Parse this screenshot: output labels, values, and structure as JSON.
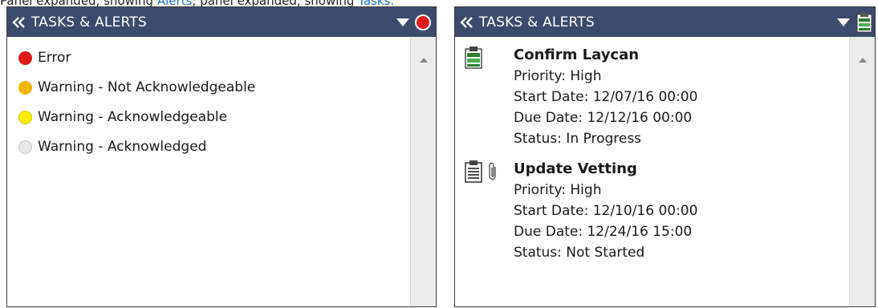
{
  "caption": {
    "text_before": "Panel expanded, showing ",
    "alerts_link": "Alerts",
    "text_middle": "; panel expanded, showing ",
    "tasks_link": "Tasks."
  },
  "alerts_panel": {
    "title": "TASKS & ALERTS",
    "legend": [
      {
        "label": "Error",
        "color": "#e01818"
      },
      {
        "label": "Warning - Not Acknowledgeable",
        "color": "#f4b400"
      },
      {
        "label": "Warning - Acknowledgeable",
        "color": "#ffee00"
      },
      {
        "label": "Warning - Acknowledged",
        "color": "#e8e8e8"
      }
    ]
  },
  "tasks_panel": {
    "title": "TASKS & ALERTS",
    "tasks": [
      {
        "title": "Confirm Laycan",
        "priority": "Priority: High",
        "start": "Start Date: 12/07/16 00:00",
        "due": "Due Date: 12/12/16 00:00",
        "status": "Status: In Progress",
        "icon": "task-green-clipboard-icon"
      },
      {
        "title": "Update Vetting",
        "priority": "Priority: High",
        "start": "Start Date: 12/10/16 00:00",
        "due": "Due Date: 12/24/16 15:00",
        "status": "Status: Not Started",
        "icon": "task-white-clipboard-icon"
      }
    ]
  },
  "colors": {
    "header_bg": "#3c4a6e",
    "link": "#1a73c8"
  }
}
